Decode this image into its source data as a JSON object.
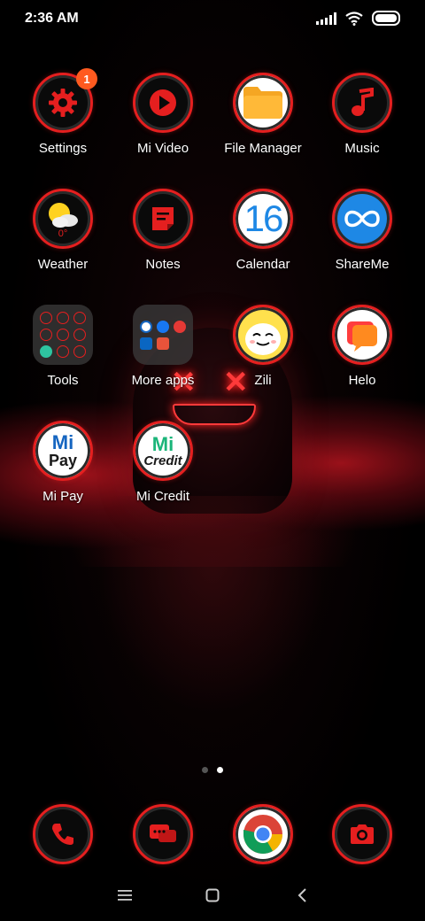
{
  "status_bar": {
    "time": "2:36 AM"
  },
  "apps": [
    {
      "label": "Settings",
      "icon": "gear-icon",
      "badge": "1"
    },
    {
      "label": "Mi Video",
      "icon": "play-icon"
    },
    {
      "label": "File Manager",
      "icon": "folder-icon"
    },
    {
      "label": "Music",
      "icon": "music-note-icon"
    },
    {
      "label": "Weather",
      "icon": "sun-cloud-icon",
      "temp": "0°"
    },
    {
      "label": "Notes",
      "icon": "note-icon"
    },
    {
      "label": "Calendar",
      "icon": "calendar-icon",
      "day": "16"
    },
    {
      "label": "ShareMe",
      "icon": "infinity-icon"
    },
    {
      "label": "Tools",
      "icon": "tools-folder-icon"
    },
    {
      "label": "More apps",
      "icon": "more-apps-folder-icon"
    },
    {
      "label": "Zili",
      "icon": "zili-face-icon"
    },
    {
      "label": "Helo",
      "icon": "helo-icon"
    },
    {
      "label": "Mi Pay",
      "icon": "mi-pay-icon",
      "logo_top": "Mi",
      "logo_bottom": "Pay"
    },
    {
      "label": "Mi Credit",
      "icon": "mi-credit-icon",
      "logo_top": "Mi",
      "logo_bottom": "Credit"
    }
  ],
  "dock": [
    {
      "name": "phone",
      "icon": "phone-icon"
    },
    {
      "name": "messages",
      "icon": "message-icon"
    },
    {
      "name": "chrome",
      "icon": "chrome-icon"
    },
    {
      "name": "camera",
      "icon": "camera-icon"
    }
  ],
  "page_indicator": {
    "count": 2,
    "active": 2
  },
  "colors": {
    "accent": "#e51f1f",
    "badge": "#ff5a1f",
    "file_manager": "#f9a825",
    "shareme": "#1e88e5",
    "mi_green": "#1bb57a"
  }
}
